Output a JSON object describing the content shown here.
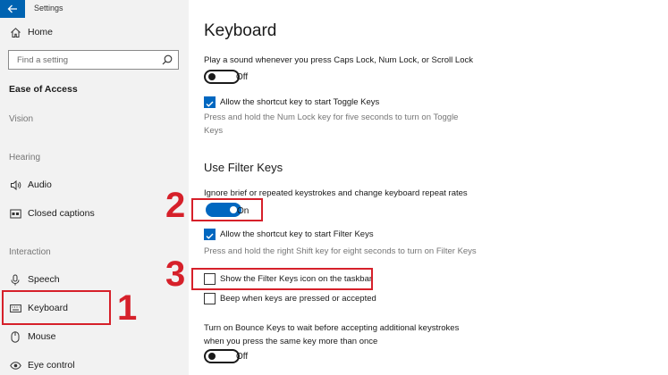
{
  "sidebar": {
    "app_title": "Settings",
    "home_label": "Home",
    "search_placeholder": "Find a setting",
    "section_title": "Ease of Access",
    "groups": {
      "vision": "Vision",
      "hearing": "Hearing",
      "interaction": "Interaction"
    },
    "items": {
      "audio": "Audio",
      "closed_captions": "Closed captions",
      "speech": "Speech",
      "keyboard": "Keyboard",
      "mouse": "Mouse",
      "eye_control": "Eye control"
    },
    "selected": "Keyboard"
  },
  "content": {
    "page_title": "Keyboard",
    "toggle_keys": {
      "description": "Play a sound whenever you press Caps Lock, Num Lock, or Scroll Lock",
      "toggle_state": "Off",
      "shortcut_label": "Allow the shortcut key to start Toggle Keys",
      "shortcut_checked": true,
      "shortcut_help": "Press and hold the Num Lock key for five seconds to turn on Toggle Keys"
    },
    "filter_keys": {
      "heading": "Use Filter Keys",
      "description": "Ignore brief or repeated keystrokes and change keyboard repeat rates",
      "toggle_state": "On",
      "shortcut_label": "Allow the shortcut key to start Filter Keys",
      "shortcut_checked": true,
      "shortcut_help": "Press and hold the right Shift key for eight seconds to turn on Filter Keys",
      "taskbar_icon_label": "Show the Filter Keys icon on the taskbar",
      "taskbar_icon_checked": false,
      "beep_label": "Beep when keys are pressed or accepted",
      "beep_checked": false
    },
    "bounce_keys": {
      "description": "Turn on Bounce Keys to wait before accepting additional keystrokes when you press the same key more than once",
      "toggle_state": "Off"
    }
  },
  "annotations": {
    "step1": "1",
    "step2": "2",
    "step3": "3"
  },
  "colors": {
    "accent": "#0067c0",
    "annotation": "#d6202a",
    "sidebar_bg": "#f2f2f2"
  }
}
